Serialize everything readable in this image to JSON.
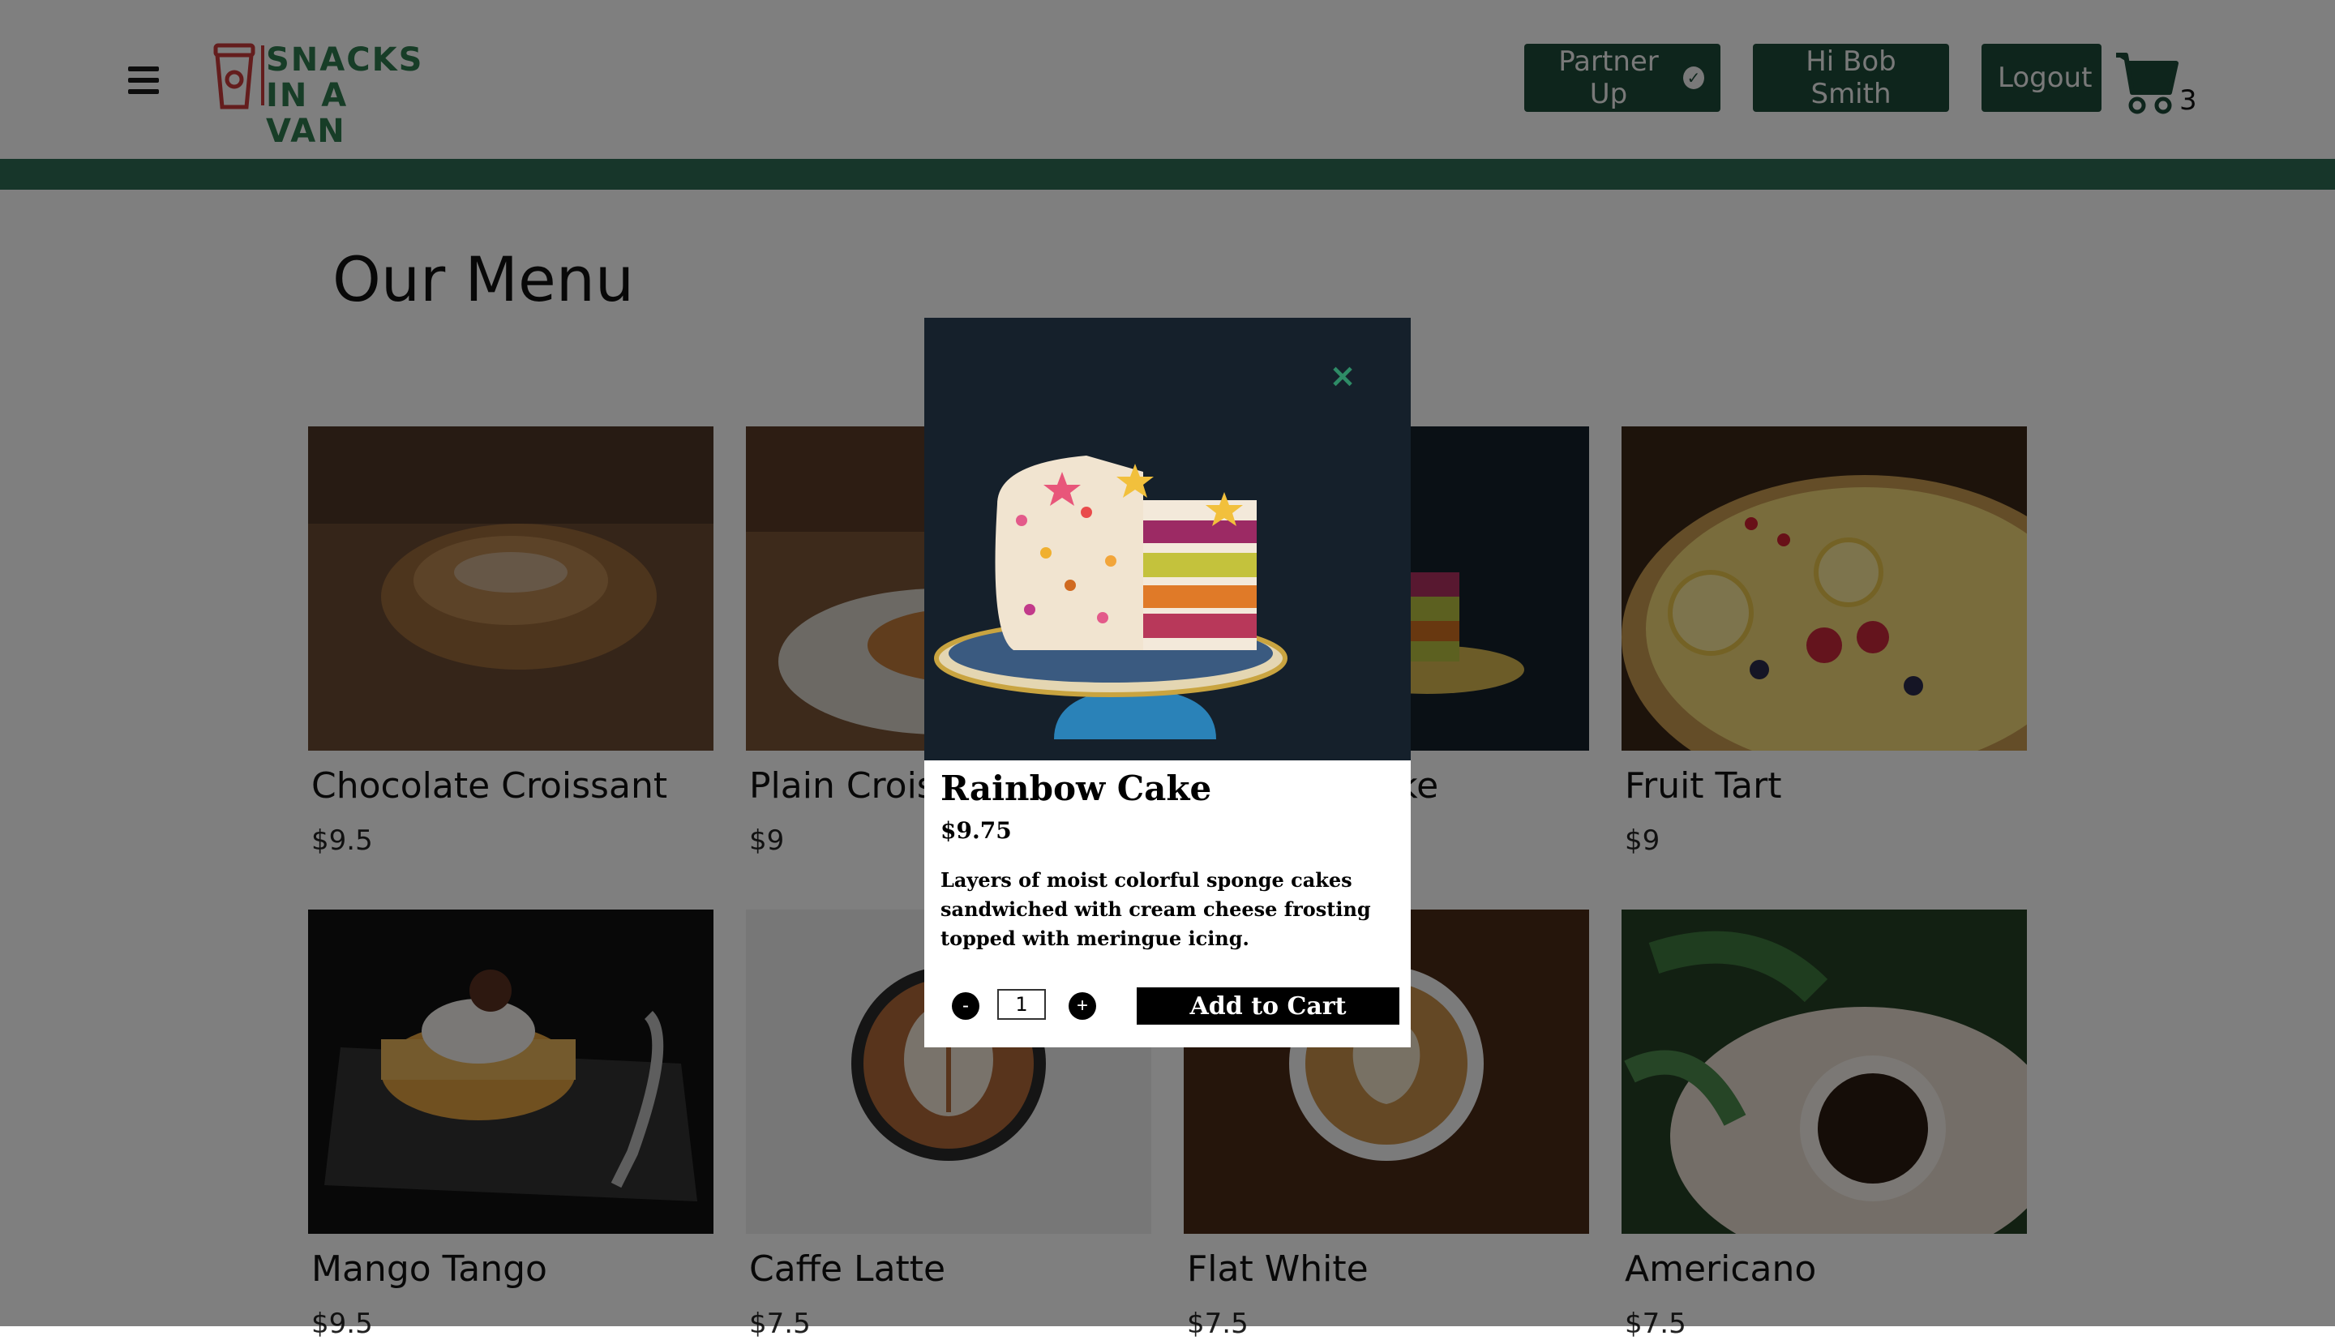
{
  "header": {
    "logo_text_line1": "SNACKS",
    "logo_text_line2": "IN A VAN",
    "partner_label": "Partner Up",
    "greeting_label": "Hi Bob Smith",
    "logout_label": "Logout",
    "cart_count": "3"
  },
  "menu": {
    "title": "Our Menu",
    "items": [
      {
        "name": "Chocolate Croissant",
        "price": "$9.5"
      },
      {
        "name": "Plain Croissant",
        "price": "$9"
      },
      {
        "name": "Rainbow Cake",
        "price": "$9.75"
      },
      {
        "name": "Fruit Tart",
        "price": "$9"
      },
      {
        "name": "Mango Tango",
        "price": "$9.5"
      },
      {
        "name": "Caffe Latte",
        "price": "$7.5"
      },
      {
        "name": "Flat White",
        "price": "$7.5"
      },
      {
        "name": "Americano",
        "price": "$7.5"
      }
    ]
  },
  "modal": {
    "close_icon": "close-icon",
    "title": "Rainbow Cake",
    "price": "$9.75",
    "description": "Layers of moist colorful sponge cakes sandwiched with cream cheese frosting topped with meringue icing.",
    "decrement_label": "-",
    "quantity": "1",
    "increment_label": "+",
    "add_label": "Add to Cart"
  },
  "colors": {
    "brand_green": "#2e7a4f",
    "nav_button_bg": "#1d4a38",
    "band": "#2f6d55"
  }
}
